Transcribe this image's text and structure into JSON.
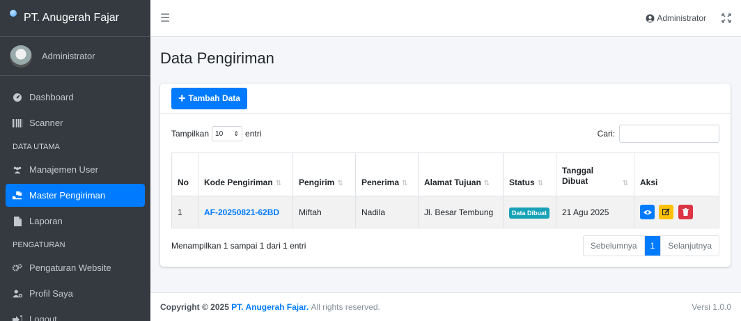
{
  "sidebar": {
    "brand": "PT. Anugerah Fajar",
    "user": "Administrator",
    "items": [
      {
        "type": "item",
        "label": "Dashboard",
        "icon": "dashboard-icon"
      },
      {
        "type": "item",
        "label": "Scanner",
        "icon": "barcode-icon"
      },
      {
        "type": "header",
        "label": "DATA UTAMA"
      },
      {
        "type": "item",
        "label": "Manajemen User",
        "icon": "users-icon"
      },
      {
        "type": "item",
        "label": "Master Pengiriman",
        "icon": "shipping-icon",
        "active": true
      },
      {
        "type": "item",
        "label": "Laporan",
        "icon": "file-icon"
      },
      {
        "type": "header",
        "label": "PENGATURAN"
      },
      {
        "type": "item",
        "label": "Pengaturan Website",
        "icon": "cogs-icon"
      },
      {
        "type": "item",
        "label": "Profil Saya",
        "icon": "user-cog-icon"
      },
      {
        "type": "item",
        "label": "Logout",
        "icon": "sign-out-icon"
      }
    ]
  },
  "topbar": {
    "user": "Administrator"
  },
  "page": {
    "title": "Data Pengiriman",
    "add_button": "Tambah Data"
  },
  "table_controls": {
    "show_prefix": "Tampilkan",
    "length_value": "10",
    "show_suffix": "entri",
    "search_label": "Cari:"
  },
  "table": {
    "headers": [
      "No",
      "Kode Pengiriman",
      "Pengirim",
      "Penerima",
      "Alamat Tujuan",
      "Status",
      "Tanggal Dibuat",
      "Aksi"
    ],
    "rows": [
      {
        "no": "1",
        "code": "AF-20250821-62BD",
        "sender": "Miftah",
        "receiver": "Nadila",
        "address": "Jl. Besar Tembung",
        "status": "Data Dibuat",
        "date": "21 Agu 2025"
      }
    ]
  },
  "pagination": {
    "info": "Menampilkan 1 sampai 1 dari 1 entri",
    "prev": "Sebelumnya",
    "current": "1",
    "next": "Selanjutnya"
  },
  "footer": {
    "copyright_prefix": "Copyright © 2025",
    "company": "PT. Anugerah Fajar.",
    "rights": "All rights reserved.",
    "version": "Versi 1.0.0"
  },
  "colors": {
    "primary": "#007bff",
    "sidebar": "#343a40",
    "badge": "#17a2b8",
    "warning": "#ffc107",
    "danger": "#dc3545"
  }
}
